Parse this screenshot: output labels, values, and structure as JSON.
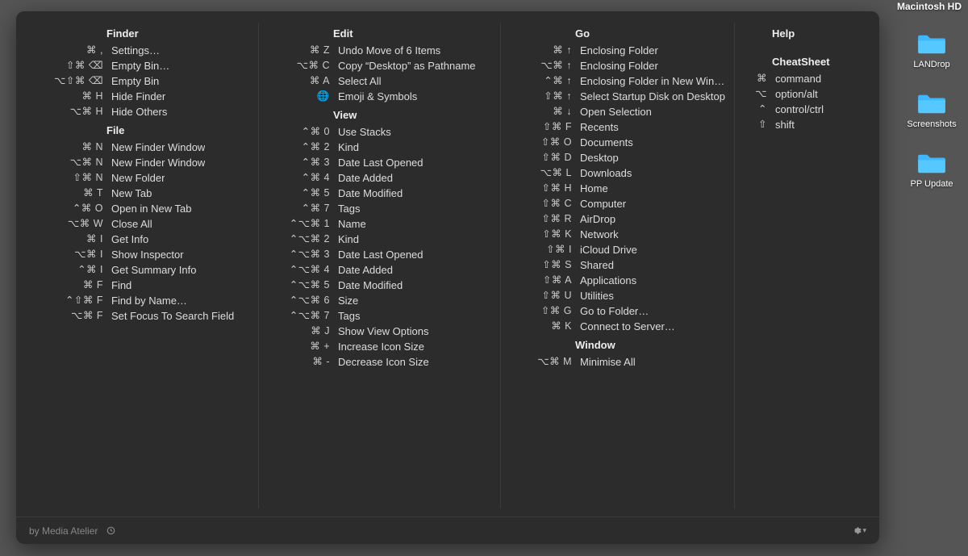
{
  "desktop": {
    "volume_label": "Macintosh HD",
    "icons": [
      {
        "label": "LANDrop"
      },
      {
        "label": "Screenshots"
      },
      {
        "label": "PP Update"
      }
    ]
  },
  "sheet": {
    "footer_credit": "by Media Atelier",
    "columns": [
      {
        "width_class": "col1",
        "sections": [
          {
            "title": "Finder",
            "rows": [
              {
                "keys": "⌘ ,",
                "action": "Settings…"
              },
              {
                "keys": "⇧⌘ ⌫",
                "action": "Empty Bin…"
              },
              {
                "keys": "⌥⇧⌘ ⌫",
                "action": "Empty Bin"
              },
              {
                "keys": "⌘ H",
                "action": "Hide Finder"
              },
              {
                "keys": "⌥⌘ H",
                "action": "Hide Others"
              }
            ]
          },
          {
            "title": "File",
            "rows": [
              {
                "keys": "⌘ N",
                "action": "New Finder Window"
              },
              {
                "keys": "⌥⌘ N",
                "action": "New Finder Window"
              },
              {
                "keys": "⇧⌘ N",
                "action": "New Folder"
              },
              {
                "keys": "⌘ T",
                "action": "New Tab"
              },
              {
                "keys": "⌃⌘ O",
                "action": "Open in New Tab"
              },
              {
                "keys": "⌥⌘ W",
                "action": "Close All"
              },
              {
                "keys": "⌘ I",
                "action": "Get Info"
              },
              {
                "keys": "⌥⌘ I",
                "action": "Show Inspector"
              },
              {
                "keys": "⌃⌘ I",
                "action": "Get Summary Info"
              },
              {
                "keys": "⌘ F",
                "action": "Find"
              },
              {
                "keys": "⌃⇧⌘ F",
                "action": "Find by Name…"
              },
              {
                "keys": "⌥⌘ F",
                "action": "Set Focus To Search Field"
              }
            ]
          }
        ]
      },
      {
        "width_class": "col2",
        "sections": [
          {
            "title": "Edit",
            "rows": [
              {
                "keys": "⌘ Z",
                "action": "Undo Move of 6 Items"
              },
              {
                "keys": "⌥⌘ C",
                "action": "Copy “Desktop” as Pathname"
              },
              {
                "keys": "⌘ A",
                "action": "Select All"
              },
              {
                "keys": "🌐",
                "action": "Emoji & Symbols"
              }
            ]
          },
          {
            "title": "View",
            "rows": [
              {
                "keys": "⌃⌘ 0",
                "action": "Use Stacks"
              },
              {
                "keys": "⌃⌘ 2",
                "action": "Kind"
              },
              {
                "keys": "⌃⌘ 3",
                "action": "Date Last Opened"
              },
              {
                "keys": "⌃⌘ 4",
                "action": "Date Added"
              },
              {
                "keys": "⌃⌘ 5",
                "action": "Date Modified"
              },
              {
                "keys": "⌃⌘ 7",
                "action": "Tags"
              },
              {
                "keys": "⌃⌥⌘ 1",
                "action": "Name"
              },
              {
                "keys": "⌃⌥⌘ 2",
                "action": "Kind"
              },
              {
                "keys": "⌃⌥⌘ 3",
                "action": "Date Last Opened"
              },
              {
                "keys": "⌃⌥⌘ 4",
                "action": "Date Added"
              },
              {
                "keys": "⌃⌥⌘ 5",
                "action": "Date Modified"
              },
              {
                "keys": "⌃⌥⌘ 6",
                "action": "Size"
              },
              {
                "keys": "⌃⌥⌘ 7",
                "action": "Tags"
              },
              {
                "keys": "⌘ J",
                "action": "Show View Options"
              },
              {
                "keys": "⌘ +",
                "action": "Increase Icon Size"
              },
              {
                "keys": "⌘ -",
                "action": "Decrease Icon Size"
              }
            ]
          }
        ]
      },
      {
        "width_class": "col3",
        "sections": [
          {
            "title": "Go",
            "rows": [
              {
                "keys": "⌘ ↑",
                "action": "Enclosing Folder"
              },
              {
                "keys": "⌥⌘ ↑",
                "action": "Enclosing Folder"
              },
              {
                "keys": "⌃⌘ ↑",
                "action": "Enclosing Folder in New Window"
              },
              {
                "keys": "⇧⌘ ↑",
                "action": "Select Startup Disk on Desktop"
              },
              {
                "keys": "⌘ ↓",
                "action": "Open Selection"
              },
              {
                "keys": "⇧⌘ F",
                "action": "Recents"
              },
              {
                "keys": "⇧⌘ O",
                "action": "Documents"
              },
              {
                "keys": "⇧⌘ D",
                "action": "Desktop"
              },
              {
                "keys": "⌥⌘ L",
                "action": "Downloads"
              },
              {
                "keys": "⇧⌘ H",
                "action": "Home"
              },
              {
                "keys": "⇧⌘ C",
                "action": "Computer"
              },
              {
                "keys": "⇧⌘ R",
                "action": "AirDrop"
              },
              {
                "keys": "⇧⌘ K",
                "action": "Network"
              },
              {
                "keys": "⇧⌘ I",
                "action": "iCloud Drive"
              },
              {
                "keys": "⇧⌘ S",
                "action": "Shared"
              },
              {
                "keys": "⇧⌘ A",
                "action": "Applications"
              },
              {
                "keys": "⇧⌘ U",
                "action": "Utilities"
              },
              {
                "keys": "⇧⌘ G",
                "action": "Go to Folder…"
              },
              {
                "keys": "⌘ K",
                "action": "Connect to Server…"
              }
            ]
          },
          {
            "title": "Window",
            "rows": [
              {
                "keys": "⌥⌘ M",
                "action": "Minimise All"
              }
            ]
          }
        ]
      },
      {
        "width_class": "col4",
        "sections": [
          {
            "title": "Help",
            "rows": []
          }
        ],
        "legend": {
          "title": "CheatSheet",
          "rows": [
            {
              "keys": "⌘",
              "action": "command"
            },
            {
              "keys": "⌥",
              "action": "option/alt"
            },
            {
              "keys": "⌃",
              "action": "control/ctrl"
            },
            {
              "keys": "⇧",
              "action": "shift"
            }
          ]
        }
      }
    ]
  }
}
